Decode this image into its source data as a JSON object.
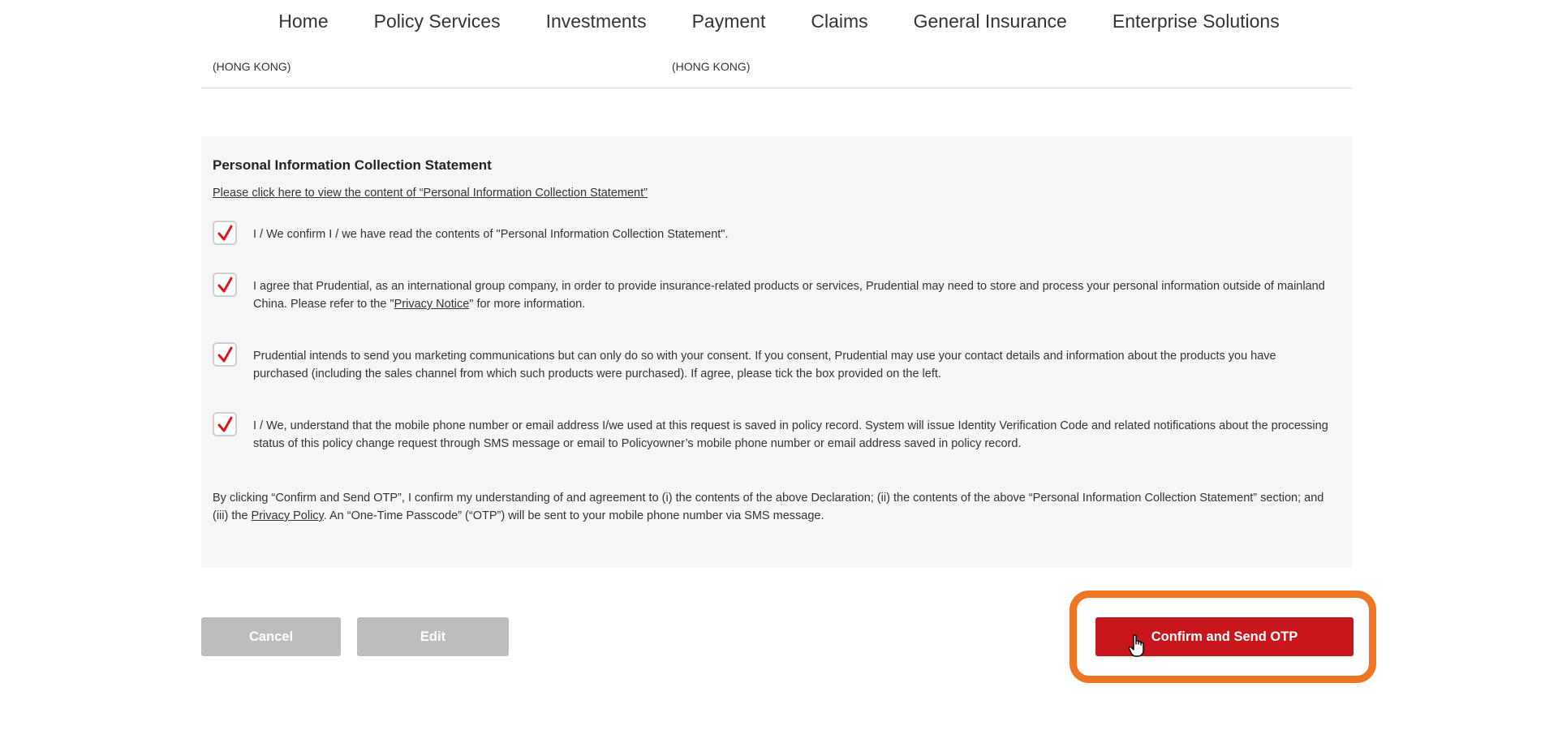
{
  "nav": {
    "items": [
      "Home",
      "Policy Services",
      "Investments",
      "Payment",
      "Claims",
      "General Insurance",
      "Enterprise Solutions"
    ]
  },
  "info_row": {
    "col1": "(HONG KONG)",
    "col2": "(HONG KONG)"
  },
  "pics": {
    "title": "Personal Information Collection Statement",
    "view_link": "Please click here to view the content of “Personal Information Collection Statement”",
    "checks": [
      {
        "checked": true,
        "text": "I / We confirm I / we have read the contents of \"Personal Information Collection Statement\"."
      },
      {
        "checked": true,
        "text_before": "I agree that Prudential, as an international group company, in order to provide insurance-related products or services, Prudential may need to store and process your personal information outside of mainland China. Please refer to the \"",
        "link": "Privacy Notice",
        "text_after": "\" for more information."
      },
      {
        "checked": true,
        "text": "Prudential intends to send you marketing communications but can only do so with your consent. If you consent, Prudential may use your contact details and information about the products you have purchased (including the sales channel from which such products were purchased). If agree, please tick the box provided on the left."
      },
      {
        "checked": true,
        "text": "I / We, understand that the mobile phone number or email address I/we used at this request is saved in policy record. System will issue Identity Verification Code and related notifications about the processing status of this policy change request through SMS message or email to Policyowner’s mobile phone number or email address saved in policy record."
      }
    ],
    "disclaimer_before": "By clicking “Confirm and Send OTP”, I confirm my understanding of and agreement to (i) the contents of the above Declaration; (ii) the contents of the above “Personal Information Collection Statement” section; and (iii) the ",
    "disclaimer_link": "Privacy Policy",
    "disclaimer_after": ". An “One-Time Passcode” (“OTP”) will be sent to your mobile phone number via SMS message."
  },
  "buttons": {
    "cancel": "Cancel",
    "edit": "Edit",
    "confirm": "Confirm and Send OTP"
  },
  "colors": {
    "brand_red": "#c9161c",
    "highlight_orange": "#ee7623",
    "disabled_gray": "#bdbdbd",
    "checkmark_red": "#e0141c"
  },
  "icons": {
    "checkbox_mark": "checkmark-icon",
    "pointer": "hand-pointer-cursor-icon"
  }
}
